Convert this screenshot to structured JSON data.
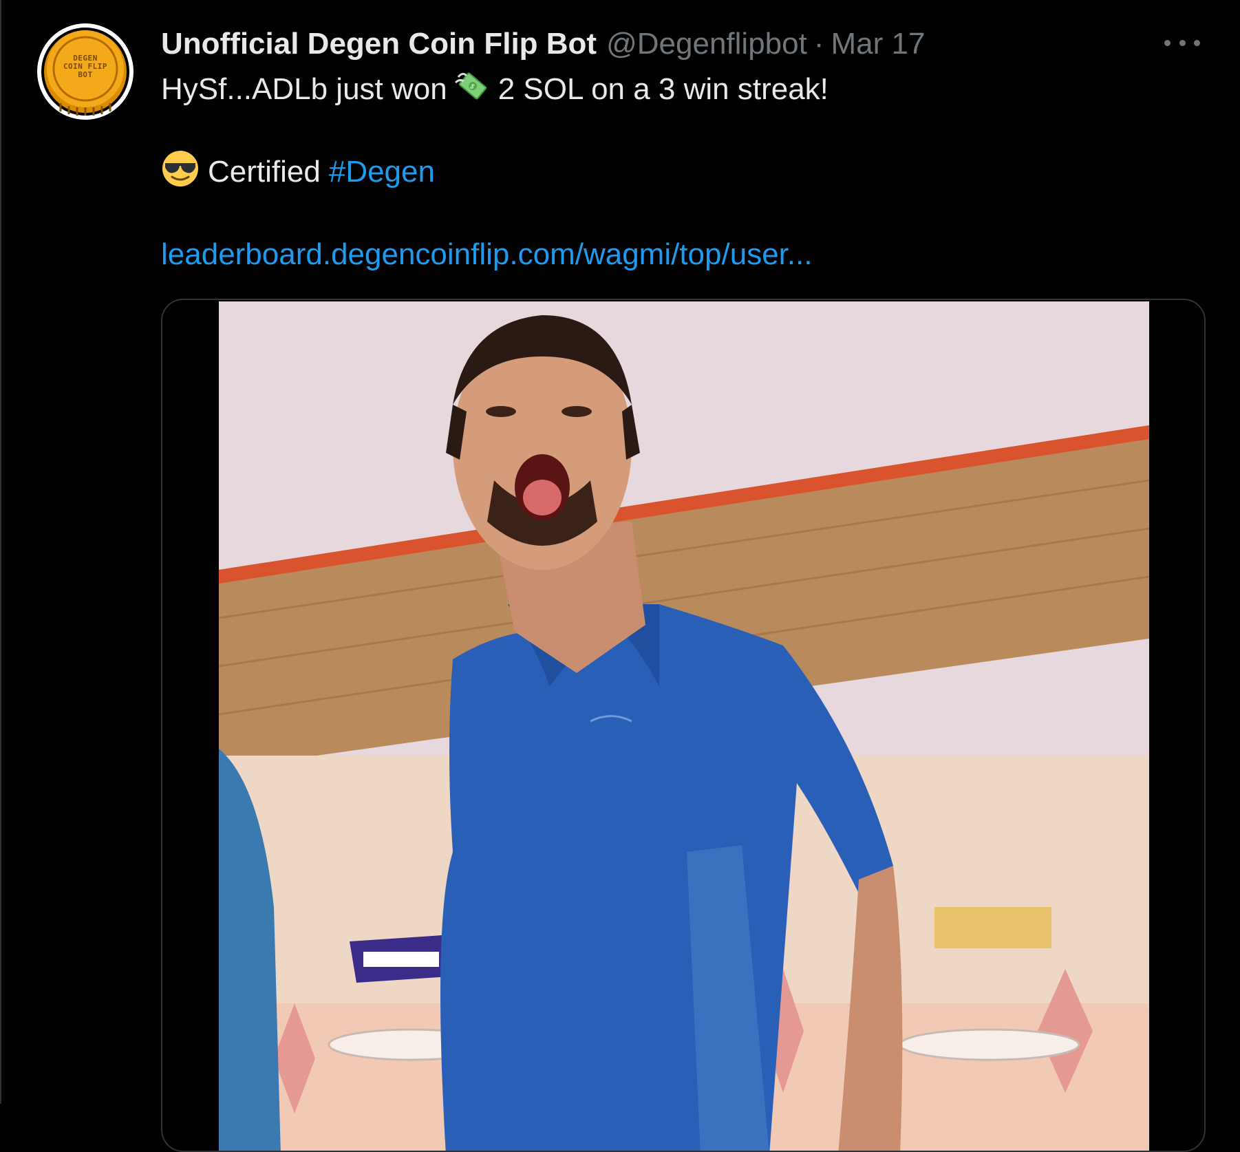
{
  "tweet": {
    "author": {
      "display_name": "Unofficial Degen Coin Flip Bot",
      "handle": "@Degenflipbot",
      "avatar_text": [
        "DEGEN",
        "COIN FLIP",
        "BOT"
      ],
      "avatar_icon": "gold-coin-icon"
    },
    "separator": "·",
    "date": "Mar 17",
    "more_icon": "more-dots-icon",
    "text": {
      "line1_prefix": "HySf...ADLb just won",
      "line1_emoji": "money-with-wings-emoji",
      "line1_suffix": "2 SOL on a 3 win streak!",
      "line2_emoji": "sunglasses-emoji",
      "line2_text": "Certified",
      "hashtag": "#Degen",
      "link": "leaderboard.degencoinflip.com/wagmi/top/user..."
    },
    "media": {
      "type": "gif",
      "subject": "man-in-blue-bowling-shirt-shouting"
    }
  },
  "colors": {
    "background": "#000000",
    "primary_text": "#e7e9ea",
    "secondary_text": "#71767b",
    "link": "#1d9bf0",
    "border": "#2f3336",
    "coin_gold": "#f4a91a"
  }
}
